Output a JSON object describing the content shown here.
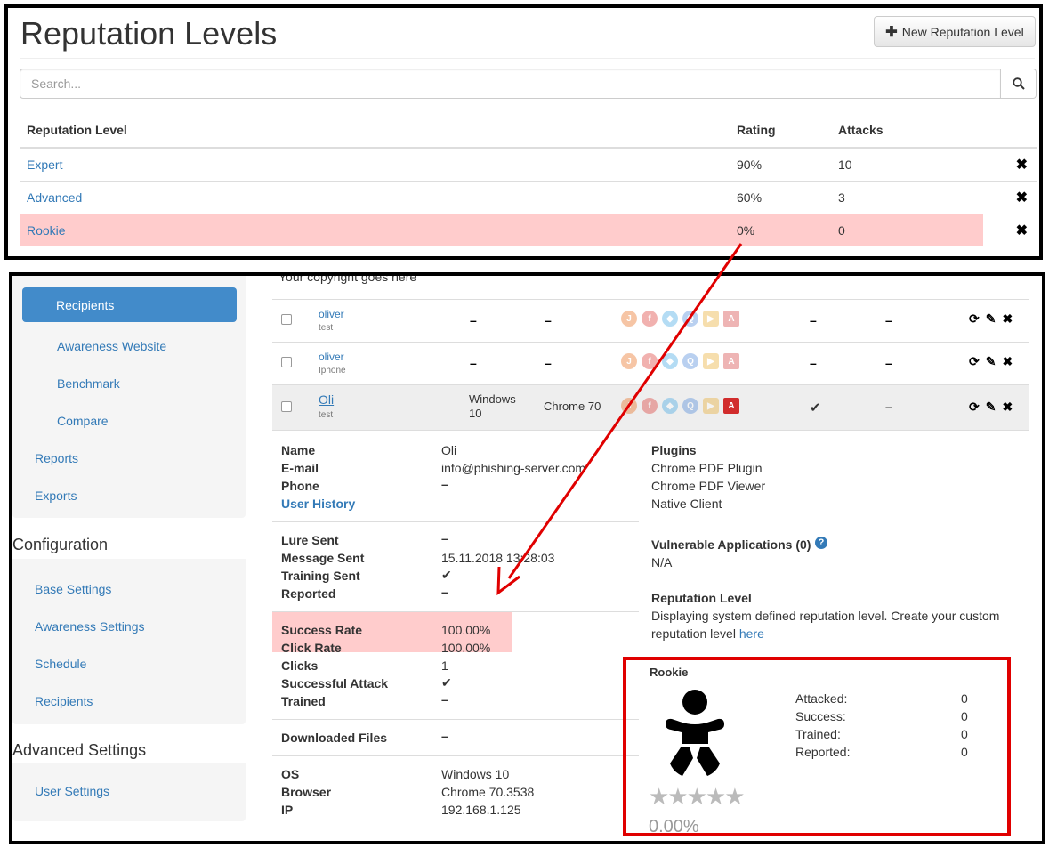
{
  "top": {
    "title": "Reputation Levels",
    "new_button": "New Reputation Level",
    "search_placeholder": "Search...",
    "columns": [
      "Reputation Level",
      "Rating",
      "Attacks"
    ],
    "rows": [
      {
        "level": "Expert",
        "rating": "90%",
        "attacks": "10"
      },
      {
        "level": "Advanced",
        "rating": "60%",
        "attacks": "3"
      },
      {
        "level": "Rookie",
        "rating": "0%",
        "attacks": "0"
      }
    ],
    "delete_glyph": "✖"
  },
  "sidebar": {
    "active": "Recipients",
    "group1": [
      "Awareness Website",
      "Benchmark",
      "Compare"
    ],
    "group1b": [
      "Reports",
      "Exports"
    ],
    "config_heading": "Configuration",
    "config_items": [
      "Base Settings",
      "Awareness Settings",
      "Schedule",
      "Recipients"
    ],
    "advanced_heading": "Advanced Settings",
    "advanced_items": [
      "User Settings"
    ]
  },
  "content": {
    "copyright": "Your copyright goes here",
    "recipients": [
      {
        "name": "oliver",
        "sub": "test"
      },
      {
        "name": "oliver",
        "sub": "Iphone"
      },
      {
        "name": "Oli",
        "sub": "test",
        "os_line1": "Windows",
        "os_line2": "10",
        "browser": "Chrome 70"
      }
    ],
    "dash": "–",
    "check": "✔",
    "details": {
      "name_label": "Name",
      "name_value": "Oli",
      "email_label": "E-mail",
      "email_value": "info@phishing-server.com",
      "phone_label": "Phone",
      "user_history": "User History",
      "lure_label": "Lure Sent",
      "message_label": "Message Sent",
      "message_value": "15.11.2018 13:28:03",
      "training_label": "Training Sent",
      "reported_label": "Reported",
      "success_label": "Success Rate",
      "success_value": "100.00%",
      "click_label": "Click Rate",
      "click_value": "100.00%",
      "clicks_label": "Clicks",
      "clicks_value": "1",
      "attack_label": "Successful Attack",
      "trained_label": "Trained",
      "downloaded_label": "Downloaded Files",
      "os_label": "OS",
      "os_value": "Windows 10",
      "browser_label": "Browser",
      "browser_value": "Chrome 70.3538",
      "ip_label": "IP",
      "ip_value": "192.168.1.125"
    },
    "right": {
      "plugins_label": "Plugins",
      "plugins": [
        "Chrome PDF Plugin",
        "Chrome PDF Viewer",
        "Native Client"
      ],
      "vuln_label": "Vulnerable Applications (0)",
      "vuln_value": "N/A",
      "rep_label": "Reputation Level",
      "rep_text_1": "Displaying system defined reputation level. Create your custom",
      "rep_text_2": "reputation level",
      "rep_link": "here",
      "card": {
        "title": "Rookie",
        "stats": [
          {
            "label": "Attacked:",
            "value": "0"
          },
          {
            "label": "Success:",
            "value": "0"
          },
          {
            "label": "Trained:",
            "value": "0"
          },
          {
            "label": "Reported:",
            "value": "0"
          }
        ],
        "stars": "★★★★★",
        "percent": "0.00%"
      }
    }
  },
  "colors": {
    "link": "#337ab7",
    "active": "#428bca",
    "highlight": "#ffcccc",
    "annotation": "#e00000"
  }
}
